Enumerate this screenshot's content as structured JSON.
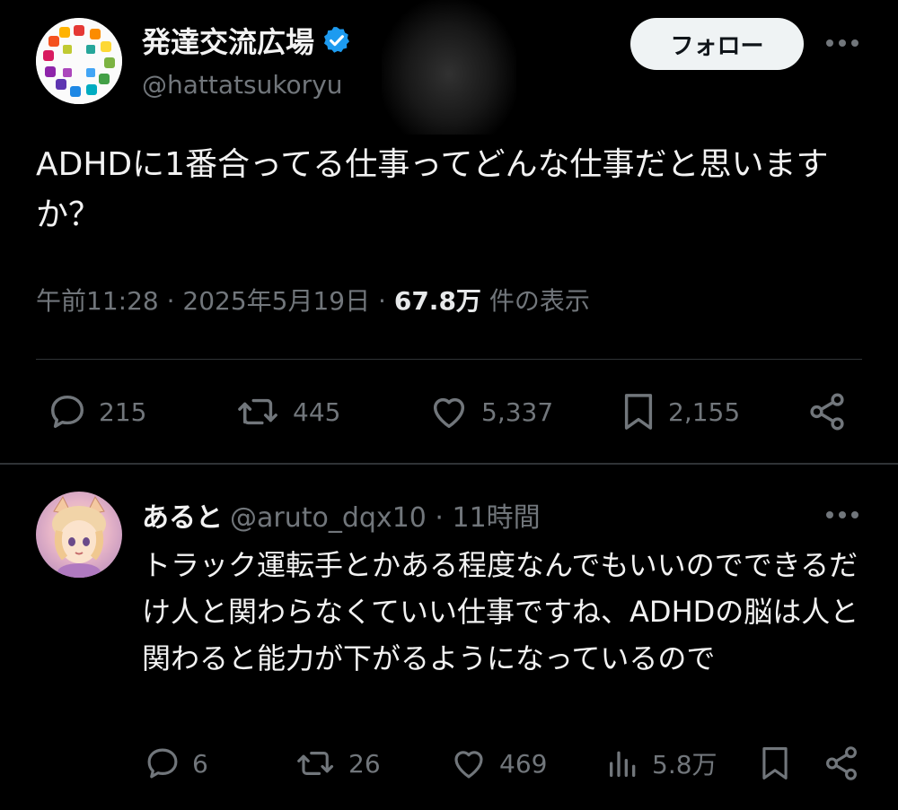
{
  "main_tweet": {
    "display_name": "発達交流広場",
    "handle": "@hattatsukoryu",
    "follow_label": "フォロー",
    "text": "ADHDに1番合ってる仕事ってどんな仕事だと思いますか？",
    "time": "午前11:28",
    "date": "2025年5月19日",
    "views_count": "67.8万",
    "views_label": "件の表示",
    "stats": {
      "replies": "215",
      "retweets": "445",
      "likes": "5,337",
      "bookmarks": "2,155"
    }
  },
  "reply": {
    "display_name": "あると",
    "handle": "@aruto_dqx10",
    "time": "11時間",
    "text": "トラック運転手とかある程度なんでもいいのでできるだけ人と関わらなくていい仕事ですね、ADHDの脳は人と関わると能力が下がるようになっているので",
    "stats": {
      "replies": "6",
      "retweets": "26",
      "likes": "469",
      "views": "5.8万"
    }
  },
  "colors": {
    "background": "#000000",
    "text": "#e7e9ea",
    "muted": "#71767b",
    "verified": "#1d9bf0",
    "follow_bg": "#eff3f4"
  },
  "icons": [
    "verified-badge-icon",
    "more-icon",
    "reply-icon",
    "retweet-icon",
    "like-icon",
    "bookmark-icon",
    "share-icon",
    "views-icon"
  ]
}
